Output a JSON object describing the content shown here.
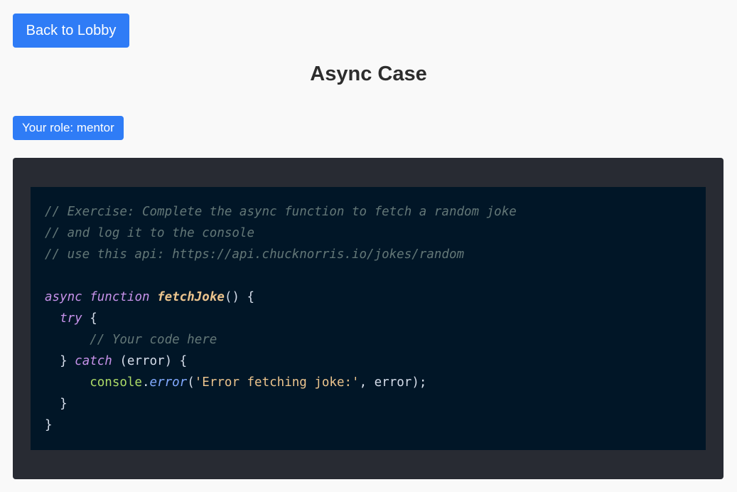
{
  "header": {
    "back_label": "Back to Lobby",
    "title": "Async Case",
    "role_label": "Your role: mentor"
  },
  "editor": {
    "lines": [
      [
        {
          "t": "// Exercise: Complete the async function to fetch a random joke",
          "c": "cm"
        }
      ],
      [
        {
          "t": "// and log it to the console",
          "c": "cm"
        }
      ],
      [
        {
          "t": "// use this api: https://api.chucknorris.io/jokes/random",
          "c": "cm"
        }
      ],
      [],
      [
        {
          "t": "async",
          "c": "kw"
        },
        {
          "t": " ",
          "c": "pl"
        },
        {
          "t": "function",
          "c": "kw"
        },
        {
          "t": " ",
          "c": "pl"
        },
        {
          "t": "fetchJoke",
          "c": "fn"
        },
        {
          "t": "() {",
          "c": "pl"
        }
      ],
      [
        {
          "t": "  ",
          "c": "pl"
        },
        {
          "t": "try",
          "c": "kw"
        },
        {
          "t": " {",
          "c": "pl"
        }
      ],
      [
        {
          "t": "      ",
          "c": "pl"
        },
        {
          "t": "// Your code here",
          "c": "cm"
        }
      ],
      [
        {
          "t": "  } ",
          "c": "pl"
        },
        {
          "t": "catch",
          "c": "kw"
        },
        {
          "t": " (error) {",
          "c": "pl"
        }
      ],
      [
        {
          "t": "      ",
          "c": "pl"
        },
        {
          "t": "console",
          "c": "obj"
        },
        {
          "t": ".",
          "c": "pl"
        },
        {
          "t": "error",
          "c": "mth"
        },
        {
          "t": "(",
          "c": "pl"
        },
        {
          "t": "'Error fetching joke:'",
          "c": "str"
        },
        {
          "t": ", error);",
          "c": "pl"
        }
      ],
      [
        {
          "t": "  }",
          "c": "pl"
        }
      ],
      [
        {
          "t": "}",
          "c": "pl"
        }
      ]
    ]
  },
  "colors": {
    "accent": "#2f7cf6",
    "page_bg": "#f9f9f9",
    "editor_frame": "#282b33",
    "editor_bg": "#011627"
  }
}
